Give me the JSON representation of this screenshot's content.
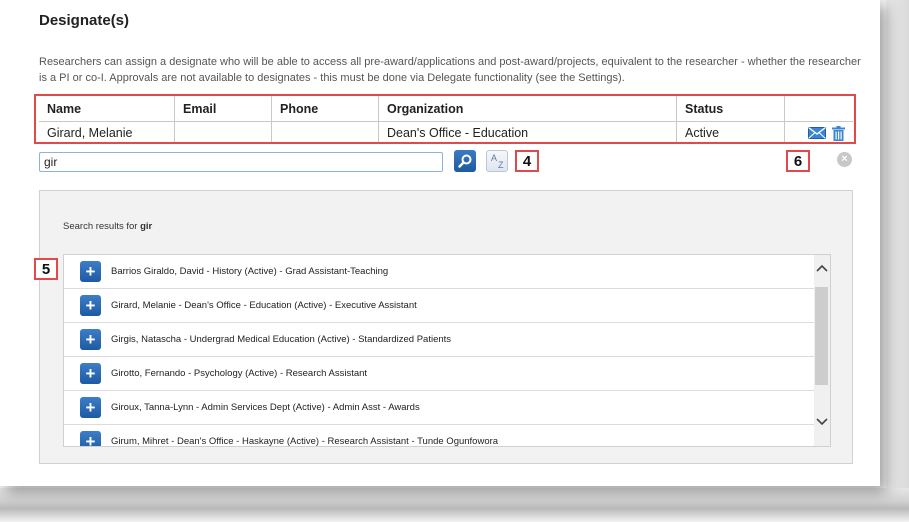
{
  "title": "Designate(s)",
  "description": "Researchers can assign a designate who will be able to access all pre-award/applications and post-award/projects, equivalent to the researcher - whether the researcher is a PI or co-I. Approvals are not available to designates - this must be done via Delegate functionality (see the Settings).",
  "table": {
    "headers": [
      "Name",
      "Email",
      "Phone",
      "Organization",
      "Status",
      ""
    ],
    "row": {
      "name": "Girard, Melanie",
      "email": "",
      "phone": "",
      "organization": "Dean's Office - Education",
      "status": "Active"
    }
  },
  "search": {
    "value": "gir",
    "sort_a": "A",
    "sort_z": "Z"
  },
  "callouts": {
    "four": "4",
    "five": "5",
    "six": "6"
  },
  "results": {
    "heading_prefix": "Search results for ",
    "heading_term": "gir",
    "items": [
      "Barrios Giraldo, David - History (Active) - Grad Assistant-Teaching",
      "Girard, Melanie - Dean's Office - Education (Active) - Executive Assistant",
      "Girgis, Natascha - Undergrad Medical Education (Active) - Standardized Patients",
      "Girotto, Fernando - Psychology (Active) - Research Assistant",
      "Giroux, Tanna-Lynn - Admin Services Dept (Active) - Admin Asst - Awards",
      "Girum, Mihret - Dean's Office - Haskayne (Active) - Research Assistant - Tunde Ogunfowora"
    ]
  },
  "icons": {
    "search": "search-icon",
    "sort": "sort-az-icon",
    "mail": "mail-icon",
    "trash": "trash-icon",
    "clear": "close-circle-icon",
    "add": "plus-icon",
    "scroll_up": "chevron-up-icon",
    "scroll_down": "chevron-down-icon"
  },
  "colors": {
    "accent_blue": "#1f5a9e",
    "callout_red": "#e04a4a"
  }
}
